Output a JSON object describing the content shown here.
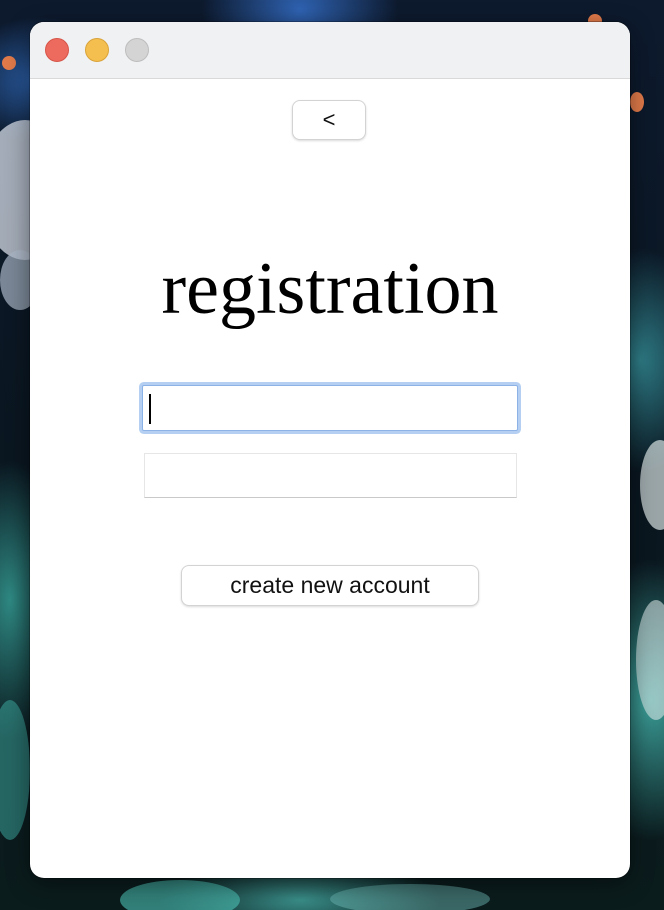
{
  "window": {
    "traffic_lights": {
      "close_color": "#ec6a5e",
      "minimize_color": "#f4bf4f",
      "zoom_color": "#d4d4d4"
    }
  },
  "toolbar": {
    "back_label": "<"
  },
  "main": {
    "title": "registration",
    "username_field": {
      "value": "",
      "placeholder": ""
    },
    "password_field": {
      "value": "",
      "placeholder": ""
    },
    "create_account_label": "create new account"
  },
  "colors": {
    "focus_ring": "#b4cff2",
    "window_bg": "#ffffff",
    "titlebar_bg": "#f0f1f3"
  }
}
